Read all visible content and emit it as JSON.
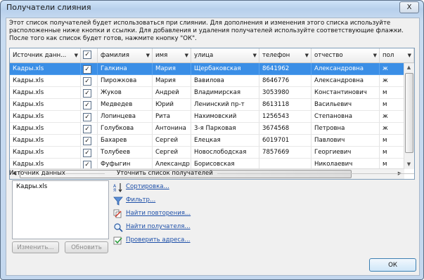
{
  "window": {
    "title": "Получатели слияния",
    "close_label": "X"
  },
  "description": "Этот список получателей будет использоваться при слиянии. Для дополнения и изменения этого списка используйте расположенные ниже кнопки и ссылки. Для добавления и удаления получателей используйте соответствующие флажки. После того как список будет готов, нажмите кнопку \"ОК\".",
  "table": {
    "headers": [
      "Источник данн...",
      "",
      "фамилия",
      "имя",
      "улица",
      "телефон",
      "отчество",
      "пол"
    ],
    "rows": [
      {
        "source": "Кадры.xls",
        "checked": true,
        "surname": "Галкина",
        "name": "Мария",
        "street": "Щербаковская",
        "phone": "8641962",
        "patronymic": "Александровна",
        "sex": "ж"
      },
      {
        "source": "Кадры.xls",
        "checked": true,
        "surname": "Пирожкова",
        "name": "Мария",
        "street": "Вавилова",
        "phone": "8646776",
        "patronymic": "Александровна",
        "sex": "ж"
      },
      {
        "source": "Кадры.xls",
        "checked": true,
        "surname": "Жуков",
        "name": "Андрей",
        "street": "Владимирская",
        "phone": "3053980",
        "patronymic": "Константинович",
        "sex": "м"
      },
      {
        "source": "Кадры.xls",
        "checked": true,
        "surname": "Медведев",
        "name": "Юрий",
        "street": "Ленинский пр-т",
        "phone": "8613118",
        "patronymic": "Васильевич",
        "sex": "м"
      },
      {
        "source": "Кадры.xls",
        "checked": true,
        "surname": "Лопинцева",
        "name": "Рита",
        "street": "Нахимовский",
        "phone": "1256543",
        "patronymic": "Степановна",
        "sex": "ж"
      },
      {
        "source": "Кадры.xls",
        "checked": true,
        "surname": "Голубкова",
        "name": "Антонина",
        "street": "3-я Парковая",
        "phone": "3674568",
        "patronymic": "Петровна",
        "sex": "ж"
      },
      {
        "source": "Кадры.xls",
        "checked": true,
        "surname": "Бахарев",
        "name": "Сергей",
        "street": "Елецкая",
        "phone": "6019701",
        "patronymic": "Павлович",
        "sex": "м"
      },
      {
        "source": "Кадры.xls",
        "checked": true,
        "surname": "Толубеев",
        "name": "Сергей",
        "street": "Новослободская",
        "phone": "7857669",
        "patronymic": "Георгиевич",
        "sex": "м"
      },
      {
        "source": "Кадры.xls",
        "checked": true,
        "surname": "Фуфыгин",
        "name": "Александр",
        "street": "Борисовская",
        "phone": "",
        "patronymic": "Николаевич",
        "sex": "м"
      }
    ],
    "selected_row": 0
  },
  "data_source": {
    "heading": "Источник данных",
    "items": [
      "Кадры.xls"
    ],
    "edit_label": "Изменить...",
    "refresh_label": "Обновить"
  },
  "refine": {
    "heading": "Уточнить список получателей",
    "links": [
      "Сортировка...",
      "Фильтр...",
      "Найти повторения...",
      "Найти получателя...",
      "Проверить адреса..."
    ]
  },
  "ok_label": "ОК",
  "check_mark": "✓"
}
